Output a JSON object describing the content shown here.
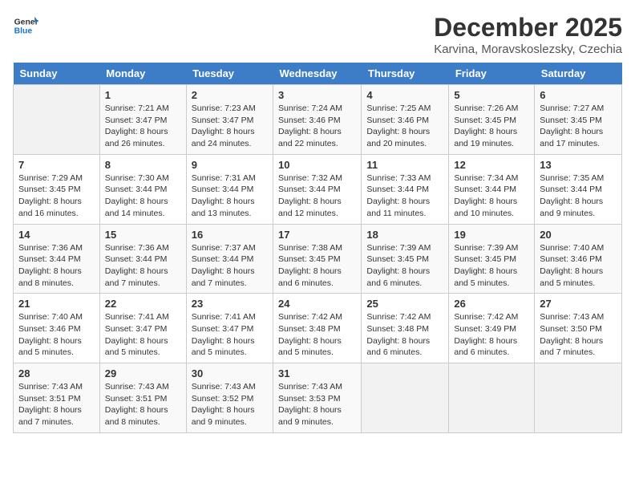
{
  "header": {
    "logo_line1": "General",
    "logo_line2": "Blue",
    "month_title": "December 2025",
    "location": "Karvina, Moravskoslezsky, Czechia"
  },
  "weekdays": [
    "Sunday",
    "Monday",
    "Tuesday",
    "Wednesday",
    "Thursday",
    "Friday",
    "Saturday"
  ],
  "weeks": [
    [
      {
        "day": "",
        "info": ""
      },
      {
        "day": "1",
        "info": "Sunrise: 7:21 AM\nSunset: 3:47 PM\nDaylight: 8 hours\nand 26 minutes."
      },
      {
        "day": "2",
        "info": "Sunrise: 7:23 AM\nSunset: 3:47 PM\nDaylight: 8 hours\nand 24 minutes."
      },
      {
        "day": "3",
        "info": "Sunrise: 7:24 AM\nSunset: 3:46 PM\nDaylight: 8 hours\nand 22 minutes."
      },
      {
        "day": "4",
        "info": "Sunrise: 7:25 AM\nSunset: 3:46 PM\nDaylight: 8 hours\nand 20 minutes."
      },
      {
        "day": "5",
        "info": "Sunrise: 7:26 AM\nSunset: 3:45 PM\nDaylight: 8 hours\nand 19 minutes."
      },
      {
        "day": "6",
        "info": "Sunrise: 7:27 AM\nSunset: 3:45 PM\nDaylight: 8 hours\nand 17 minutes."
      }
    ],
    [
      {
        "day": "7",
        "info": "Sunrise: 7:29 AM\nSunset: 3:45 PM\nDaylight: 8 hours\nand 16 minutes."
      },
      {
        "day": "8",
        "info": "Sunrise: 7:30 AM\nSunset: 3:44 PM\nDaylight: 8 hours\nand 14 minutes."
      },
      {
        "day": "9",
        "info": "Sunrise: 7:31 AM\nSunset: 3:44 PM\nDaylight: 8 hours\nand 13 minutes."
      },
      {
        "day": "10",
        "info": "Sunrise: 7:32 AM\nSunset: 3:44 PM\nDaylight: 8 hours\nand 12 minutes."
      },
      {
        "day": "11",
        "info": "Sunrise: 7:33 AM\nSunset: 3:44 PM\nDaylight: 8 hours\nand 11 minutes."
      },
      {
        "day": "12",
        "info": "Sunrise: 7:34 AM\nSunset: 3:44 PM\nDaylight: 8 hours\nand 10 minutes."
      },
      {
        "day": "13",
        "info": "Sunrise: 7:35 AM\nSunset: 3:44 PM\nDaylight: 8 hours\nand 9 minutes."
      }
    ],
    [
      {
        "day": "14",
        "info": "Sunrise: 7:36 AM\nSunset: 3:44 PM\nDaylight: 8 hours\nand 8 minutes."
      },
      {
        "day": "15",
        "info": "Sunrise: 7:36 AM\nSunset: 3:44 PM\nDaylight: 8 hours\nand 7 minutes."
      },
      {
        "day": "16",
        "info": "Sunrise: 7:37 AM\nSunset: 3:44 PM\nDaylight: 8 hours\nand 7 minutes."
      },
      {
        "day": "17",
        "info": "Sunrise: 7:38 AM\nSunset: 3:45 PM\nDaylight: 8 hours\nand 6 minutes."
      },
      {
        "day": "18",
        "info": "Sunrise: 7:39 AM\nSunset: 3:45 PM\nDaylight: 8 hours\nand 6 minutes."
      },
      {
        "day": "19",
        "info": "Sunrise: 7:39 AM\nSunset: 3:45 PM\nDaylight: 8 hours\nand 5 minutes."
      },
      {
        "day": "20",
        "info": "Sunrise: 7:40 AM\nSunset: 3:46 PM\nDaylight: 8 hours\nand 5 minutes."
      }
    ],
    [
      {
        "day": "21",
        "info": "Sunrise: 7:40 AM\nSunset: 3:46 PM\nDaylight: 8 hours\nand 5 minutes."
      },
      {
        "day": "22",
        "info": "Sunrise: 7:41 AM\nSunset: 3:47 PM\nDaylight: 8 hours\nand 5 minutes."
      },
      {
        "day": "23",
        "info": "Sunrise: 7:41 AM\nSunset: 3:47 PM\nDaylight: 8 hours\nand 5 minutes."
      },
      {
        "day": "24",
        "info": "Sunrise: 7:42 AM\nSunset: 3:48 PM\nDaylight: 8 hours\nand 5 minutes."
      },
      {
        "day": "25",
        "info": "Sunrise: 7:42 AM\nSunset: 3:48 PM\nDaylight: 8 hours\nand 6 minutes."
      },
      {
        "day": "26",
        "info": "Sunrise: 7:42 AM\nSunset: 3:49 PM\nDaylight: 8 hours\nand 6 minutes."
      },
      {
        "day": "27",
        "info": "Sunrise: 7:43 AM\nSunset: 3:50 PM\nDaylight: 8 hours\nand 7 minutes."
      }
    ],
    [
      {
        "day": "28",
        "info": "Sunrise: 7:43 AM\nSunset: 3:51 PM\nDaylight: 8 hours\nand 7 minutes."
      },
      {
        "day": "29",
        "info": "Sunrise: 7:43 AM\nSunset: 3:51 PM\nDaylight: 8 hours\nand 8 minutes."
      },
      {
        "day": "30",
        "info": "Sunrise: 7:43 AM\nSunset: 3:52 PM\nDaylight: 8 hours\nand 9 minutes."
      },
      {
        "day": "31",
        "info": "Sunrise: 7:43 AM\nSunset: 3:53 PM\nDaylight: 8 hours\nand 9 minutes."
      },
      {
        "day": "",
        "info": ""
      },
      {
        "day": "",
        "info": ""
      },
      {
        "day": "",
        "info": ""
      }
    ]
  ]
}
